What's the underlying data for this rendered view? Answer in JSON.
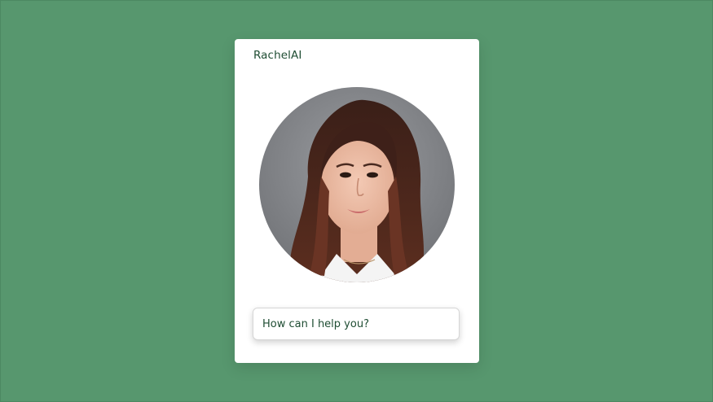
{
  "app": {
    "title": "RachelAI"
  },
  "avatar": {
    "icon": "person-portrait",
    "alt": "avatar"
  },
  "chat": {
    "prompt_text": "How can I help you?"
  },
  "colors": {
    "background": "#57976e",
    "card": "#ffffff",
    "text": "#1f4d33"
  }
}
